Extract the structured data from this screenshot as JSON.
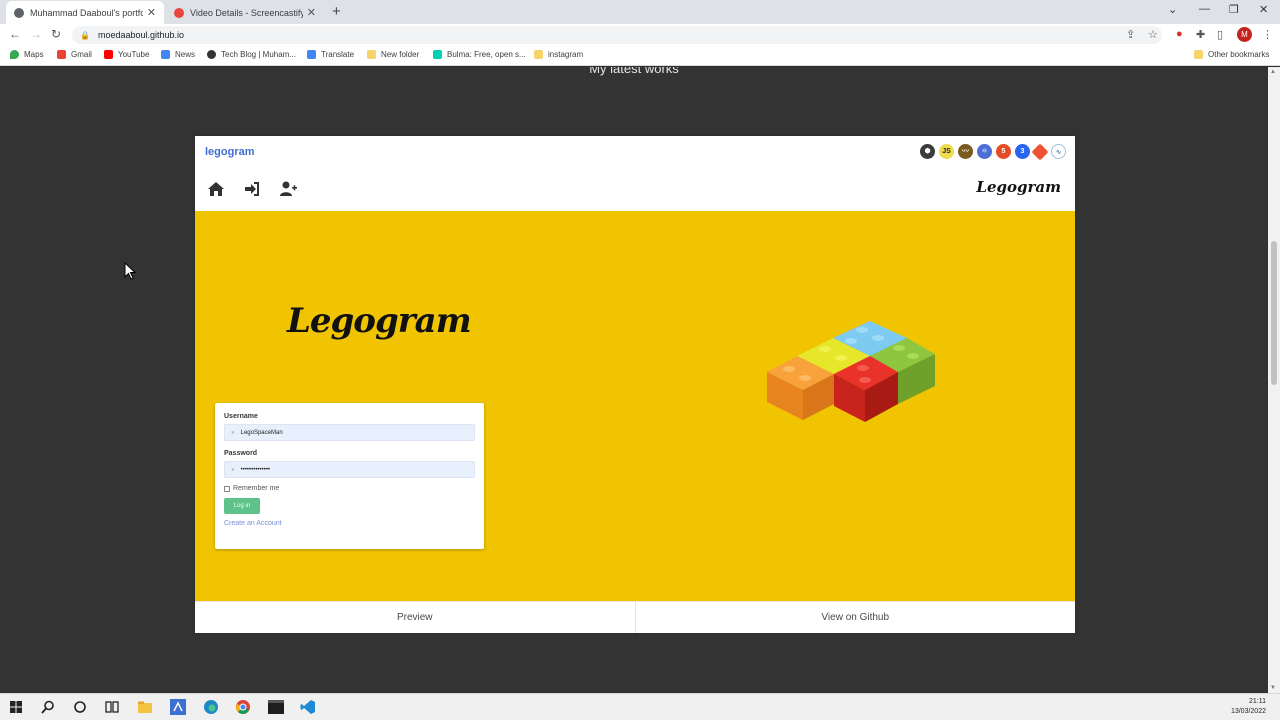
{
  "browser": {
    "tabs": [
      {
        "title": "Muhammad Daaboul's portfolio",
        "active": true
      },
      {
        "title": "Video Details - Screencastify",
        "active": false
      }
    ],
    "url": "moedaaboul.github.io",
    "profile_initial": "M",
    "bookmarks": [
      "Maps",
      "Gmail",
      "YouTube",
      "News",
      "Tech Blog | Muham...",
      "Translate",
      "New folder",
      "Bulma: Free, open s...",
      "instagram"
    ],
    "other_bookmarks": "Other bookmarks"
  },
  "page": {
    "section_heading": "My latest works",
    "card": {
      "title": "legogram",
      "tech_icons": [
        "node-icon",
        "js-icon",
        "handlebars-icon",
        "react-icon",
        "html5-icon",
        "css3-icon",
        "git-icon",
        "mysql-icon"
      ],
      "tech_js_label": "JS",
      "brand_small": "Legogram",
      "hero_logo": "Legogram",
      "login": {
        "username_label": "Username",
        "username_value": "LegoSpaceMan",
        "password_label": "Password",
        "password_value": "••••••••••••••",
        "remember_label": "Remember me",
        "login_button": "Log in",
        "create_account": "Create an Account"
      },
      "footer": {
        "preview": "Preview",
        "github": "View on Github"
      }
    }
  },
  "taskbar": {
    "time": "21:11",
    "date": "13/03/2022"
  },
  "colors": {
    "hero_yellow": "#f0c400",
    "page_bg": "#333333",
    "link_blue": "#3d6fd1",
    "login_green": "#5fc28a"
  }
}
